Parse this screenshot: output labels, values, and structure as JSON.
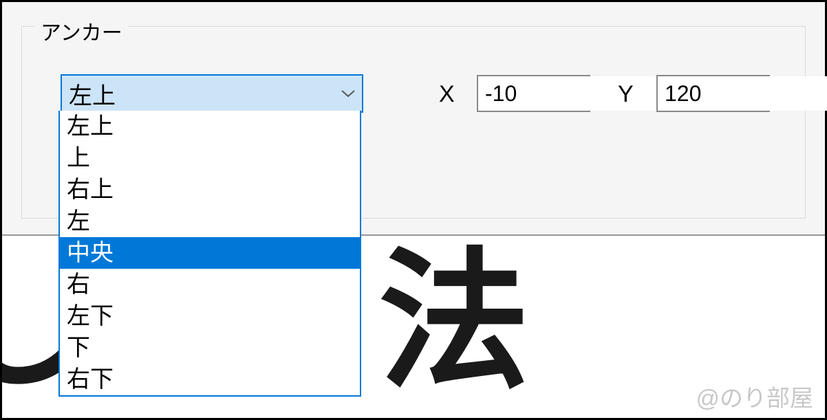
{
  "fieldset": {
    "label": "アンカー"
  },
  "anchor": {
    "selected": "左上",
    "options": [
      "左上",
      "上",
      "右上",
      "左",
      "中央",
      "右",
      "左下",
      "下",
      "右下"
    ],
    "highlighted_index": 4
  },
  "coords": {
    "x_label": "X",
    "x_value": "-10",
    "y_label": "Y",
    "y_value": "120"
  },
  "background": {
    "text": "し　　法"
  },
  "watermark": "@のり部屋"
}
